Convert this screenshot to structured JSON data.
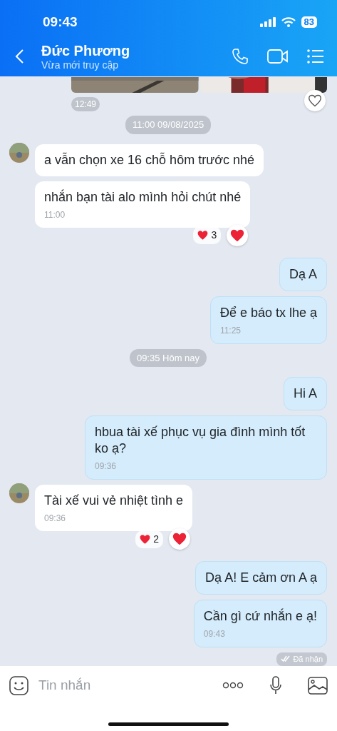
{
  "status_bar": {
    "time": "09:43",
    "battery": "83"
  },
  "header": {
    "name": "Đức Phương",
    "presence": "Vừa mới truy cập"
  },
  "items": [
    {
      "kind": "photos",
      "time": "12:49",
      "liked": false
    },
    {
      "kind": "date",
      "text": "11:00 09/08/2025"
    },
    {
      "kind": "incoming",
      "avatar": true,
      "text": "a vẫn chọn xe 16 chỗ hôm trước nhé"
    },
    {
      "kind": "incoming",
      "avatar": false,
      "text": "nhắn bạn tài alo mình hỏi chút nhé",
      "time": "11:00",
      "reaction_count": "3",
      "liked": true
    },
    {
      "kind": "outgoing",
      "text": "Dạ A"
    },
    {
      "kind": "outgoing",
      "text": "Để e báo tx lhe ạ",
      "time": "11:25"
    },
    {
      "kind": "date",
      "text": "09:35 Hôm nay"
    },
    {
      "kind": "outgoing",
      "text": "Hi A"
    },
    {
      "kind": "outgoing",
      "text": "hbua tài xế phục vụ gia đình mình tốt ko ạ?",
      "time": "09:36"
    },
    {
      "kind": "incoming",
      "avatar": true,
      "text": "Tài xế vui vẻ nhiệt tình e",
      "time": "09:36",
      "reaction_count": "2",
      "liked": true
    },
    {
      "kind": "outgoing",
      "text": "Dạ A! E cảm ơn A ạ"
    },
    {
      "kind": "outgoing",
      "text": "Cần gì cứ nhắn e ạ!",
      "time": "09:43"
    },
    {
      "kind": "status",
      "text": "Đã nhận"
    }
  ],
  "composer": {
    "placeholder": "Tin nhắn"
  }
}
